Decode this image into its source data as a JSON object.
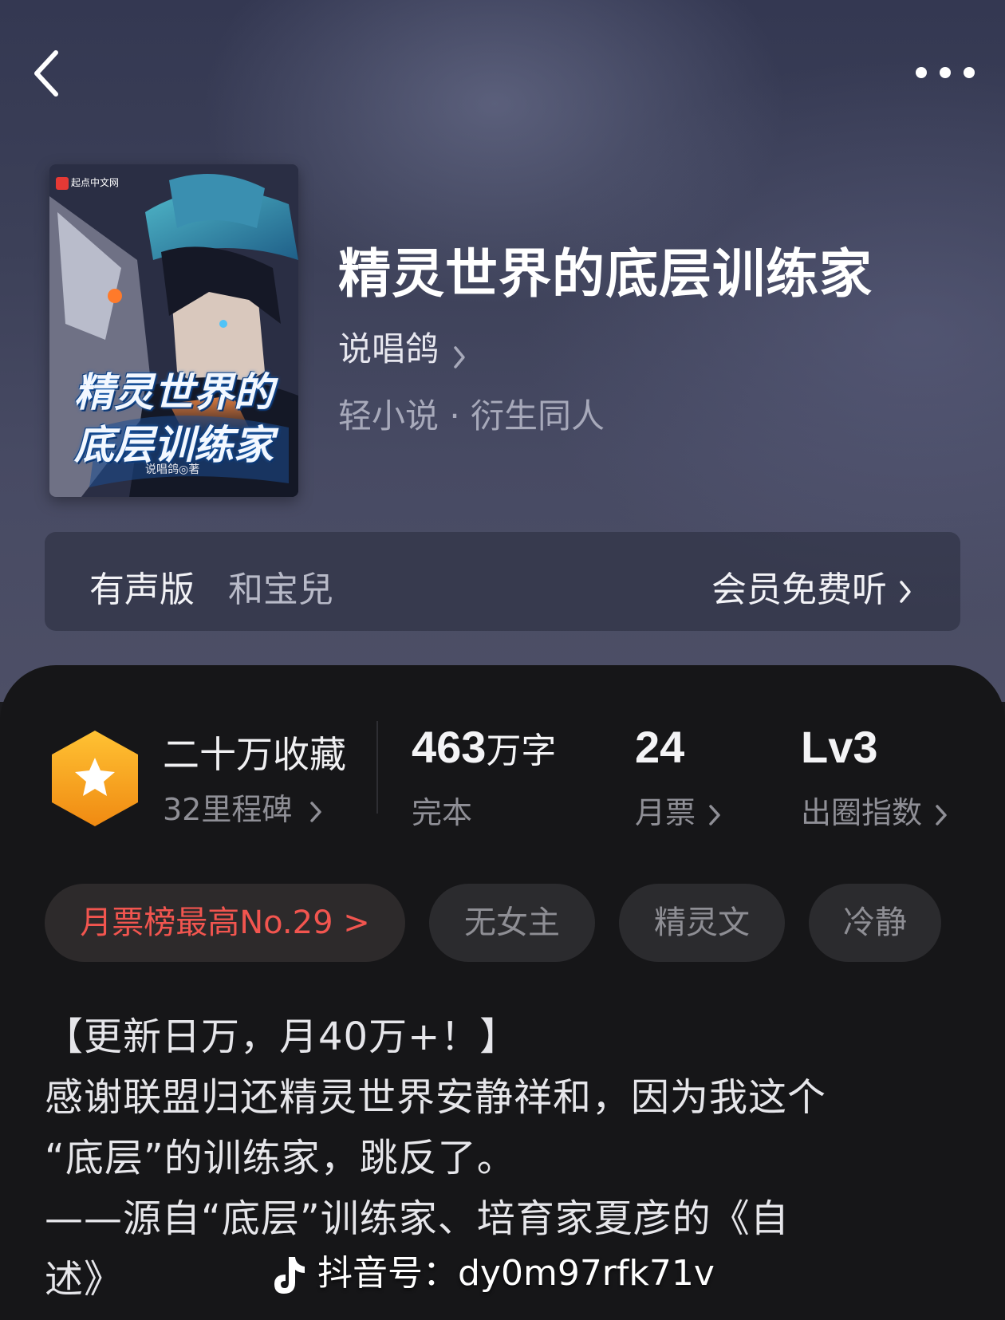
{
  "header": {
    "back_icon": "chevron-left-icon",
    "more_icon": "more-horizontal-icon"
  },
  "book": {
    "title": "精灵世界的底层训练家",
    "author": "说唱鸽",
    "categories": "轻小说 · 衍生同人",
    "cover": {
      "publisher": "起点中文网",
      "title_line1": "精灵世界的",
      "title_line2": "底层训练家",
      "author_credit": "说唱鸽◎著"
    }
  },
  "audio": {
    "label": "有声版",
    "narrator": "和宝兒",
    "cta": "会员免费听"
  },
  "stats": {
    "collection": {
      "main": "二十万收藏",
      "sub": "32里程碑"
    },
    "words": {
      "value": "463",
      "unit": "万字",
      "label": "完本"
    },
    "monthly_votes": {
      "value": "24",
      "label": "月票"
    },
    "circle_index": {
      "value": "Lv3",
      "label": "出圈指数"
    }
  },
  "tags": [
    {
      "label": "月票榜最高No.29 >",
      "type": "rank"
    },
    {
      "label": "无女主",
      "type": "tag"
    },
    {
      "label": "精灵文",
      "type": "tag"
    },
    {
      "label": "冷静",
      "type": "tag"
    }
  ],
  "description": [
    "【更新日万，月40万+！】",
    "感谢联盟归还精灵世界安静祥和，因为我这个",
    "“底层”的训练家，跳反了。",
    "——源自“底层”训练家、培育家夏彦的《自",
    "述》"
  ],
  "watermark": {
    "text": "抖音号：dy0m97rfk71v",
    "icon": "tiktok-logo-icon"
  },
  "colors": {
    "accent_red": "#f2554f",
    "badge_orange": "#f7a21b",
    "panel_bg": "#161618"
  }
}
